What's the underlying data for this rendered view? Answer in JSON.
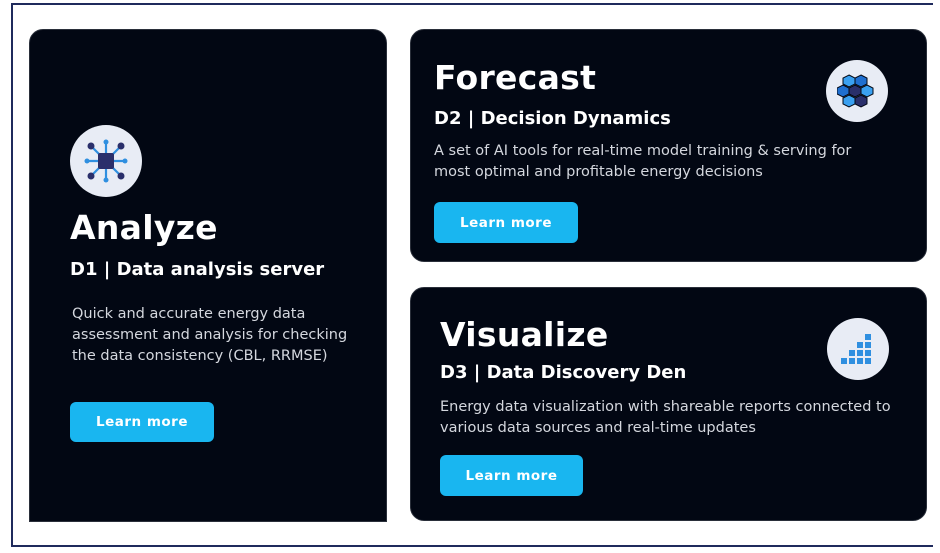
{
  "cards": [
    {
      "title": "Analyze",
      "subtitle": "D1 | Data analysis server",
      "description": "Quick and accurate energy data assessment and analysis for checking the data consistency (CBL, RRMSE)",
      "button_label": "Learn more",
      "icon": "network-nodes-icon"
    },
    {
      "title": "Forecast",
      "subtitle": "D2 | Decision Dynamics",
      "description": "A set of AI tools for real-time model training & serving for most optimal and profitable energy decisions",
      "button_label": "Learn more",
      "icon": "brain-hexagon-icon"
    },
    {
      "title": "Visualize",
      "subtitle": "D3 | Data Discovery Den",
      "description": "Energy data visualization with shareable reports connected to various data sources and real-time updates",
      "button_label": "Learn more",
      "icon": "bar-grid-chart-icon"
    }
  ],
  "colors": {
    "card_background": "#020713",
    "button": "#19b6f0",
    "icon_background": "#e8ecf5",
    "icon_primary": "#2a2f6b",
    "icon_accent": "#2f8fe0"
  }
}
